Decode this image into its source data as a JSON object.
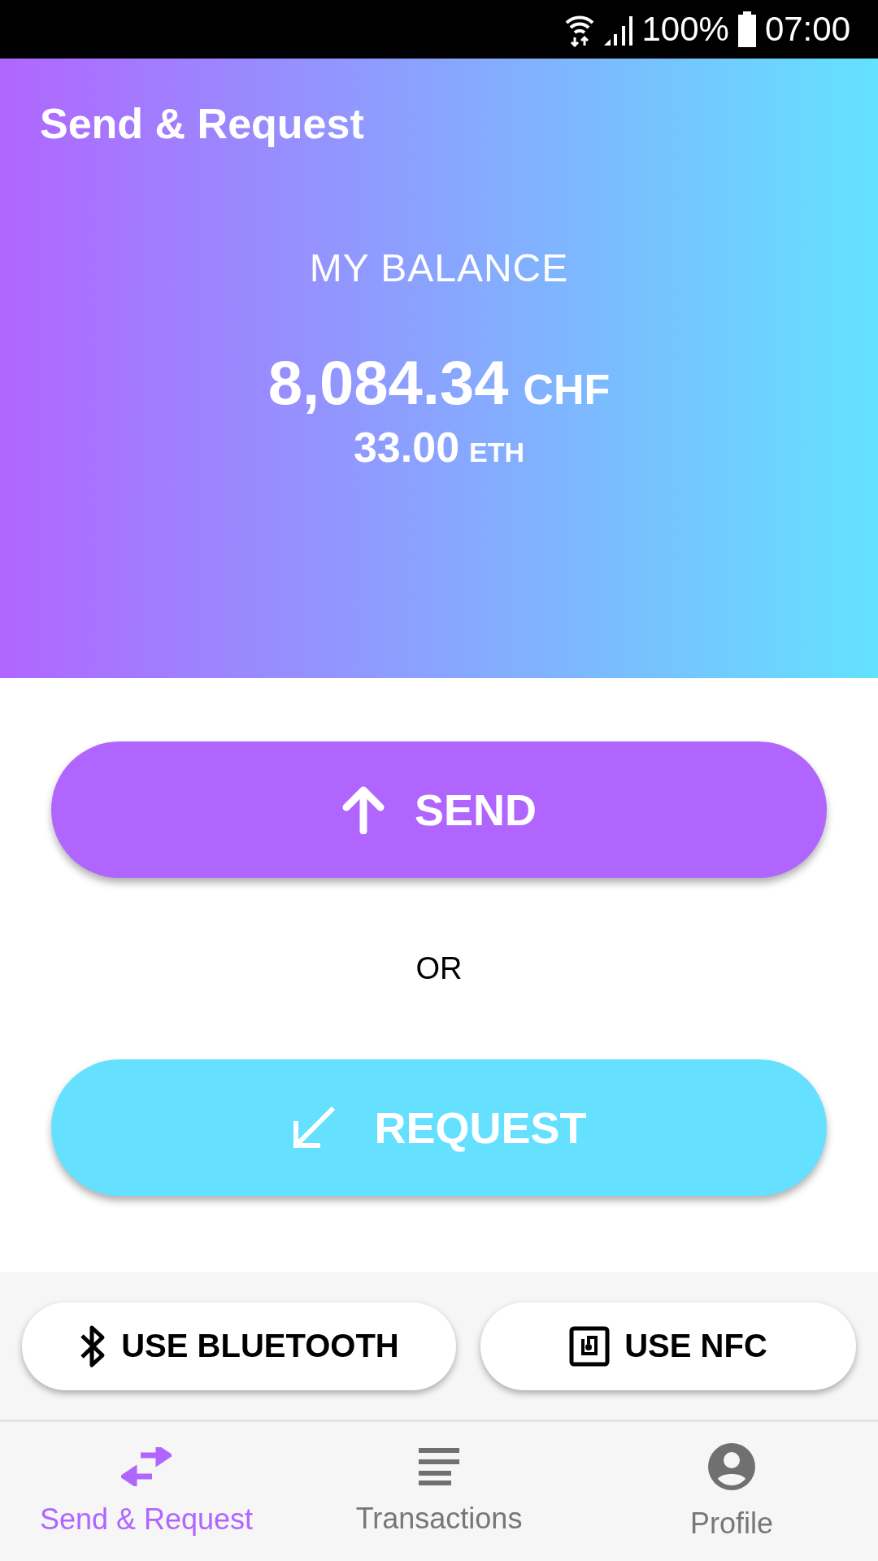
{
  "status_bar": {
    "battery": "100%",
    "time": "07:00"
  },
  "header": {
    "title": "Send & Request",
    "balance_label": "MY BALANCE",
    "amount": "8,084.34",
    "currency": "CHF",
    "secondary_amount": "33.00",
    "secondary_currency": "ETH"
  },
  "actions": [
    {
      "kind": "send",
      "label": "SEND"
    },
    {
      "kind": "request",
      "label": "REQUEST"
    }
  ],
  "separator": "OR",
  "options": [
    {
      "kind": "bluetooth",
      "label": "USE BLUETOOTH"
    },
    {
      "kind": "nfc",
      "label": "USE NFC"
    }
  ],
  "nav": [
    {
      "kind": "swap",
      "label": "Send & Request",
      "selected": true
    },
    {
      "kind": "list",
      "label": "Transactions",
      "selected": false
    },
    {
      "kind": "profile",
      "label": "Profile",
      "selected": false
    }
  ]
}
